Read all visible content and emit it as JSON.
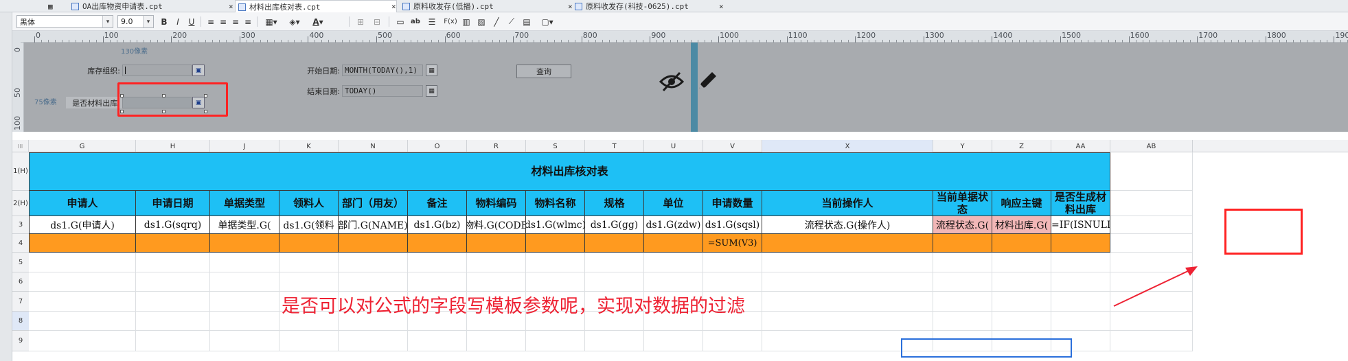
{
  "tabs": [
    {
      "label": "OA出库物资申请表.cpt",
      "active": false
    },
    {
      "label": "材料出库核对表.cpt",
      "active": true
    },
    {
      "label": "原料收发存(低播).cpt",
      "active": false
    },
    {
      "label": "原料收发存(科技-0625).cpt",
      "active": false
    }
  ],
  "toolbar": {
    "font_family": "黑体",
    "font_size": "9.0",
    "bold": "B",
    "italic": "I",
    "underline": "U",
    "text_color_icon": "A",
    "abc_icon": "ab",
    "formula_icon": "F(x)"
  },
  "ruler": {
    "h_labels": [
      "0",
      "100",
      "200",
      "300",
      "400",
      "500",
      "600",
      "700",
      "800",
      "900",
      "1000",
      "1100",
      "1200",
      "1300",
      "1400",
      "1500",
      "1600",
      "1700",
      "1800",
      "1900"
    ],
    "v_labels": [
      "0",
      "50",
      "100"
    ]
  },
  "param_panel": {
    "size_label_130": "130像素",
    "size_label_75": "75像素",
    "stock_org_label": "库存组织:",
    "stock_org_value": "",
    "material_out_label": "是否材料出库:",
    "material_out_value": "",
    "start_date_label": "开始日期:",
    "start_date_value": "MONTH(TODAY(),1)",
    "end_date_label": "结束日期:",
    "end_date_value": "TODAY()",
    "query_button": "查询"
  },
  "sheet": {
    "columns": [
      "G",
      "H",
      "J",
      "K",
      "N",
      "O",
      "R",
      "S",
      "T",
      "U",
      "V",
      "X",
      "Y",
      "Z",
      "AA",
      "AB"
    ],
    "rows": [
      "1(H)",
      "2(H)",
      "3",
      "4",
      "5",
      "6",
      "7",
      "8",
      "9"
    ],
    "title": "材料出库核对表",
    "headers": [
      "申请人",
      "申请日期",
      "单据类型",
      "领料人",
      "部门（用友）",
      "备注",
      "物料编码",
      "物料名称",
      "规格",
      "单位",
      "申请数量",
      "当前操作人",
      "当前单据状态",
      "响应主键",
      "是否生成材料出库"
    ],
    "row3": [
      "ds1.G(申请人)",
      "ds1.G(sqrq)",
      "单据类型.G(",
      "ds1.G(领料",
      "部门.G(NAME)",
      "ds1.G(bz)",
      "物料.G(CODE",
      "ds1.G(wlmc)",
      "ds1.G(gg)",
      "ds1.G(zdw)",
      "ds1.G(sqsl)",
      "流程状态.G(操作人)",
      "流程状态.G(",
      "材料出库.G(",
      "=IF(ISNULL("
    ],
    "row4_sum": "=SUM(V3)"
  },
  "annotation": {
    "text": "是否可以对公式的字段写模板参数呢，实现对数据的过滤",
    "color": "#ee2233"
  },
  "colors": {
    "header_blue": "#1ec0f5",
    "sum_orange": "#ff9a1f",
    "pink_cell": "#f2b7b7",
    "param_bg": "#a8abaf"
  }
}
